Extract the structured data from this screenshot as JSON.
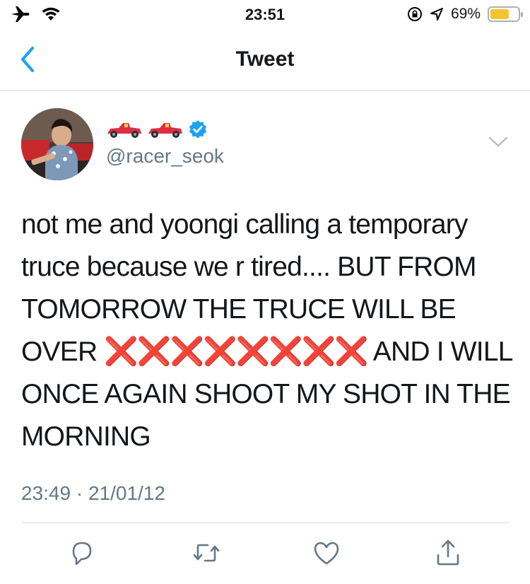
{
  "status_bar": {
    "time": "23:51",
    "battery_percent": "69%",
    "battery_level": 0.69,
    "icons": [
      "airplane-mode-icon",
      "wifi-icon",
      "orientation-lock-icon",
      "location-icon",
      "battery-icon"
    ]
  },
  "nav": {
    "title": "Tweet",
    "back_icon": "chevron-left-icon"
  },
  "tweet": {
    "display_name_emoji": "race-car-emoji x2",
    "verified": true,
    "handle": "@racer_seok",
    "text_before": "not me and yoongi calling a temporary truce because we r tired.... BUT FROM TOMORROW THE TRUCE WILL BE OVER ",
    "crosses": "❌❌❌❌❌❌❌❌",
    "text_after": " AND I WILL ONCE AGAIN SHOOT MY SHOT IN THE MORNING",
    "timestamp": "23:49 · 21/01/12"
  },
  "actions": [
    "reply-icon",
    "retweet-icon",
    "like-icon",
    "share-icon"
  ],
  "colors": {
    "accent": "#1da1f2",
    "text": "#14171a",
    "secondary": "#657786",
    "divider": "#d8dde1",
    "cross": "#dd2e44",
    "battery": "#f4c430"
  }
}
